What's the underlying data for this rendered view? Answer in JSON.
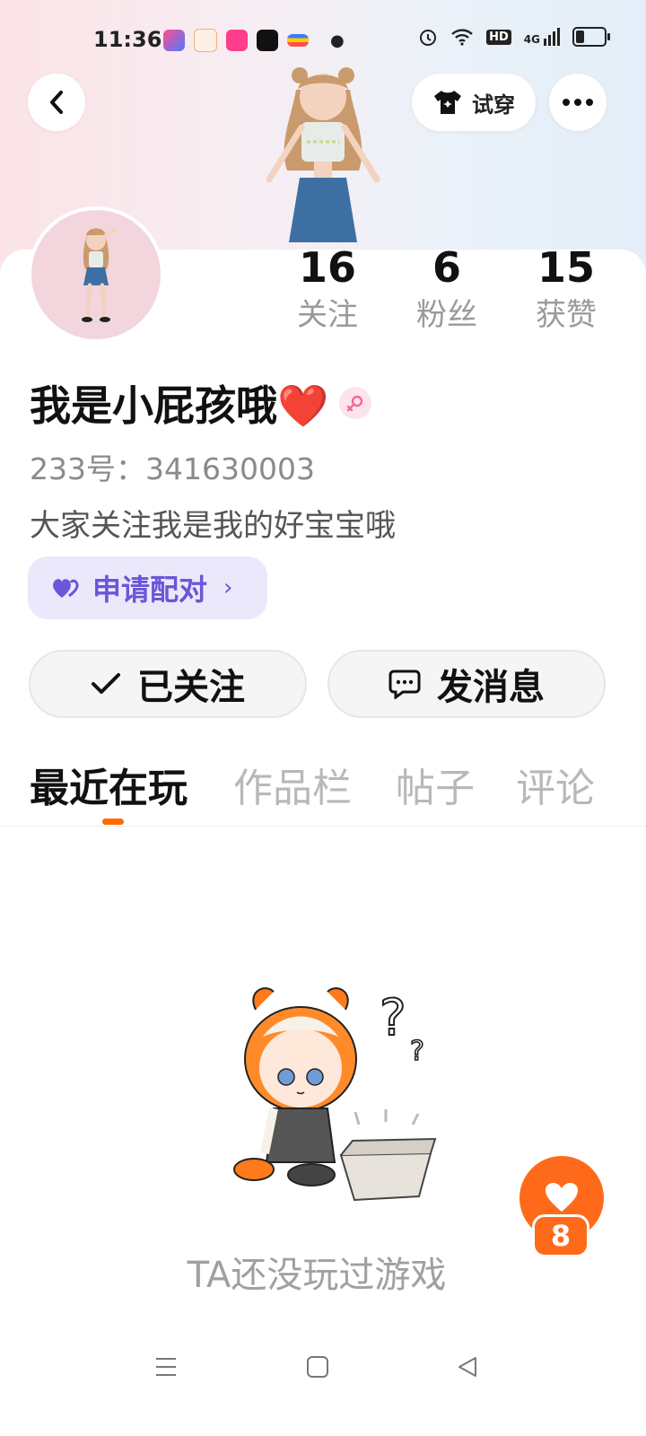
{
  "status_bar": {
    "time": "11:36",
    "network": "4G",
    "hd": "HD",
    "battery_level": 0.35
  },
  "header": {
    "tryon_label": "试穿"
  },
  "profile": {
    "stats": [
      {
        "value": "16",
        "label": "关注"
      },
      {
        "value": "6",
        "label": "粉丝"
      },
      {
        "value": "15",
        "label": "获赞"
      }
    ],
    "name": "我是小屁孩哦❤️",
    "gender": "female",
    "id_text": "233号：341630003",
    "bio": "大家关注我是我的好宝宝哦",
    "pair_label": "申请配对"
  },
  "actions": {
    "follow_label": "已关注",
    "message_label": "发消息"
  },
  "tabs": [
    {
      "label": "最近在玩",
      "active": true
    },
    {
      "label": "作品栏",
      "active": false
    },
    {
      "label": "帖子",
      "active": false
    },
    {
      "label": "评论",
      "active": false
    }
  ],
  "empty_state": {
    "text": "TA还没玩过游戏"
  },
  "like_float": {
    "count": "8"
  },
  "colors": {
    "accent": "#ff6a1a",
    "pair": "#6b56d9",
    "pair_bg": "#ece8fb"
  }
}
